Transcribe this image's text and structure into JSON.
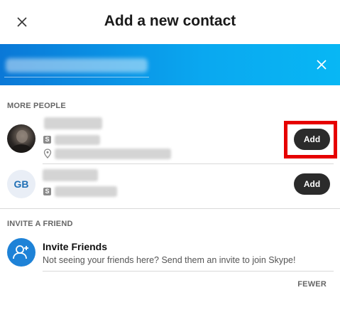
{
  "header": {
    "title": "Add a new contact",
    "close_icon": "close-icon"
  },
  "search": {
    "value": "",
    "clear_icon": "close-icon"
  },
  "more_people": {
    "label": "MORE PEOPLE",
    "contacts": [
      {
        "avatar": "photo",
        "add_label": "Add",
        "icons": [
          "skype-icon",
          "location-pin-icon"
        ]
      },
      {
        "avatar_initials": "GB",
        "add_label": "Add",
        "icons": [
          "skype-icon"
        ]
      }
    ]
  },
  "invite": {
    "label": "INVITE A FRIEND",
    "title": "Invite Friends",
    "subtitle": "Not seeing your friends here? Send them an invite to join Skype!",
    "icon": "add-person-icon"
  },
  "footer": {
    "fewer_label": "FEWER"
  },
  "colors": {
    "accent_blue": "#0a8fe6",
    "button_dark": "#2b2b2b",
    "highlight_red": "#e60000"
  }
}
